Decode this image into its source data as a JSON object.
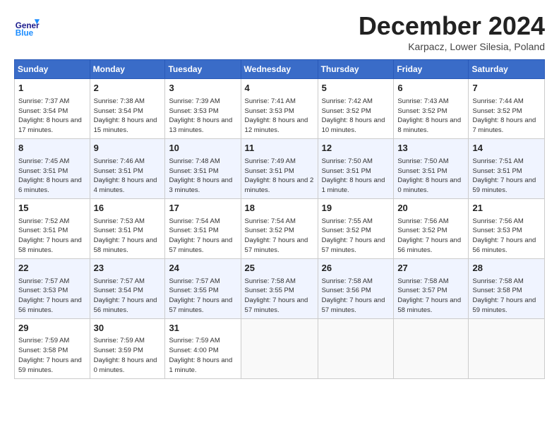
{
  "header": {
    "logo": {
      "general": "General",
      "blue": "Blue"
    },
    "title": "December 2024",
    "location": "Karpacz, Lower Silesia, Poland"
  },
  "calendar": {
    "days_of_week": [
      "Sunday",
      "Monday",
      "Tuesday",
      "Wednesday",
      "Thursday",
      "Friday",
      "Saturday"
    ],
    "weeks": [
      [
        {
          "day": "",
          "info": ""
        },
        {
          "day": "2",
          "sunrise": "Sunrise: 7:38 AM",
          "sunset": "Sunset: 3:54 PM",
          "daylight": "Daylight: 8 hours and 15 minutes."
        },
        {
          "day": "3",
          "sunrise": "Sunrise: 7:39 AM",
          "sunset": "Sunset: 3:53 PM",
          "daylight": "Daylight: 8 hours and 13 minutes."
        },
        {
          "day": "4",
          "sunrise": "Sunrise: 7:41 AM",
          "sunset": "Sunset: 3:53 PM",
          "daylight": "Daylight: 8 hours and 12 minutes."
        },
        {
          "day": "5",
          "sunrise": "Sunrise: 7:42 AM",
          "sunset": "Sunset: 3:52 PM",
          "daylight": "Daylight: 8 hours and 10 minutes."
        },
        {
          "day": "6",
          "sunrise": "Sunrise: 7:43 AM",
          "sunset": "Sunset: 3:52 PM",
          "daylight": "Daylight: 8 hours and 8 minutes."
        },
        {
          "day": "7",
          "sunrise": "Sunrise: 7:44 AM",
          "sunset": "Sunset: 3:52 PM",
          "daylight": "Daylight: 8 hours and 7 minutes."
        }
      ],
      [
        {
          "day": "1",
          "sunrise": "Sunrise: 7:37 AM",
          "sunset": "Sunset: 3:54 PM",
          "daylight": "Daylight: 8 hours and 17 minutes."
        },
        {
          "day": "9",
          "sunrise": "Sunrise: 7:46 AM",
          "sunset": "Sunset: 3:51 PM",
          "daylight": "Daylight: 8 hours and 4 minutes."
        },
        {
          "day": "10",
          "sunrise": "Sunrise: 7:48 AM",
          "sunset": "Sunset: 3:51 PM",
          "daylight": "Daylight: 8 hours and 3 minutes."
        },
        {
          "day": "11",
          "sunrise": "Sunrise: 7:49 AM",
          "sunset": "Sunset: 3:51 PM",
          "daylight": "Daylight: 8 hours and 2 minutes."
        },
        {
          "day": "12",
          "sunrise": "Sunrise: 7:50 AM",
          "sunset": "Sunset: 3:51 PM",
          "daylight": "Daylight: 8 hours and 1 minute."
        },
        {
          "day": "13",
          "sunrise": "Sunrise: 7:50 AM",
          "sunset": "Sunset: 3:51 PM",
          "daylight": "Daylight: 8 hours and 0 minutes."
        },
        {
          "day": "14",
          "sunrise": "Sunrise: 7:51 AM",
          "sunset": "Sunset: 3:51 PM",
          "daylight": "Daylight: 7 hours and 59 minutes."
        }
      ],
      [
        {
          "day": "8",
          "sunrise": "Sunrise: 7:45 AM",
          "sunset": "Sunset: 3:51 PM",
          "daylight": "Daylight: 8 hours and 6 minutes."
        },
        {
          "day": "16",
          "sunrise": "Sunrise: 7:53 AM",
          "sunset": "Sunset: 3:51 PM",
          "daylight": "Daylight: 7 hours and 58 minutes."
        },
        {
          "day": "17",
          "sunrise": "Sunrise: 7:54 AM",
          "sunset": "Sunset: 3:51 PM",
          "daylight": "Daylight: 7 hours and 57 minutes."
        },
        {
          "day": "18",
          "sunrise": "Sunrise: 7:54 AM",
          "sunset": "Sunset: 3:52 PM",
          "daylight": "Daylight: 7 hours and 57 minutes."
        },
        {
          "day": "19",
          "sunrise": "Sunrise: 7:55 AM",
          "sunset": "Sunset: 3:52 PM",
          "daylight": "Daylight: 7 hours and 57 minutes."
        },
        {
          "day": "20",
          "sunrise": "Sunrise: 7:56 AM",
          "sunset": "Sunset: 3:52 PM",
          "daylight": "Daylight: 7 hours and 56 minutes."
        },
        {
          "day": "21",
          "sunrise": "Sunrise: 7:56 AM",
          "sunset": "Sunset: 3:53 PM",
          "daylight": "Daylight: 7 hours and 56 minutes."
        }
      ],
      [
        {
          "day": "15",
          "sunrise": "Sunrise: 7:52 AM",
          "sunset": "Sunset: 3:51 PM",
          "daylight": "Daylight: 7 hours and 58 minutes."
        },
        {
          "day": "23",
          "sunrise": "Sunrise: 7:57 AM",
          "sunset": "Sunset: 3:54 PM",
          "daylight": "Daylight: 7 hours and 56 minutes."
        },
        {
          "day": "24",
          "sunrise": "Sunrise: 7:57 AM",
          "sunset": "Sunset: 3:55 PM",
          "daylight": "Daylight: 7 hours and 57 minutes."
        },
        {
          "day": "25",
          "sunrise": "Sunrise: 7:58 AM",
          "sunset": "Sunset: 3:55 PM",
          "daylight": "Daylight: 7 hours and 57 minutes."
        },
        {
          "day": "26",
          "sunrise": "Sunrise: 7:58 AM",
          "sunset": "Sunset: 3:56 PM",
          "daylight": "Daylight: 7 hours and 57 minutes."
        },
        {
          "day": "27",
          "sunrise": "Sunrise: 7:58 AM",
          "sunset": "Sunset: 3:57 PM",
          "daylight": "Daylight: 7 hours and 58 minutes."
        },
        {
          "day": "28",
          "sunrise": "Sunrise: 7:58 AM",
          "sunset": "Sunset: 3:58 PM",
          "daylight": "Daylight: 7 hours and 59 minutes."
        }
      ],
      [
        {
          "day": "22",
          "sunrise": "Sunrise: 7:57 AM",
          "sunset": "Sunset: 3:53 PM",
          "daylight": "Daylight: 7 hours and 56 minutes."
        },
        {
          "day": "30",
          "sunrise": "Sunrise: 7:59 AM",
          "sunset": "Sunset: 3:59 PM",
          "daylight": "Daylight: 8 hours and 0 minutes."
        },
        {
          "day": "31",
          "sunrise": "Sunrise: 7:59 AM",
          "sunset": "Sunset: 4:00 PM",
          "daylight": "Daylight: 8 hours and 1 minute."
        },
        {
          "day": "",
          "info": ""
        },
        {
          "day": "",
          "info": ""
        },
        {
          "day": "",
          "info": ""
        },
        {
          "day": "",
          "info": ""
        }
      ],
      [
        {
          "day": "29",
          "sunrise": "Sunrise: 7:59 AM",
          "sunset": "Sunset: 3:58 PM",
          "daylight": "Daylight: 7 hours and 59 minutes."
        },
        {
          "day": "",
          "info": ""
        },
        {
          "day": "",
          "info": ""
        },
        {
          "day": "",
          "info": ""
        },
        {
          "day": "",
          "info": ""
        },
        {
          "day": "",
          "info": ""
        },
        {
          "day": "",
          "info": ""
        }
      ]
    ]
  }
}
